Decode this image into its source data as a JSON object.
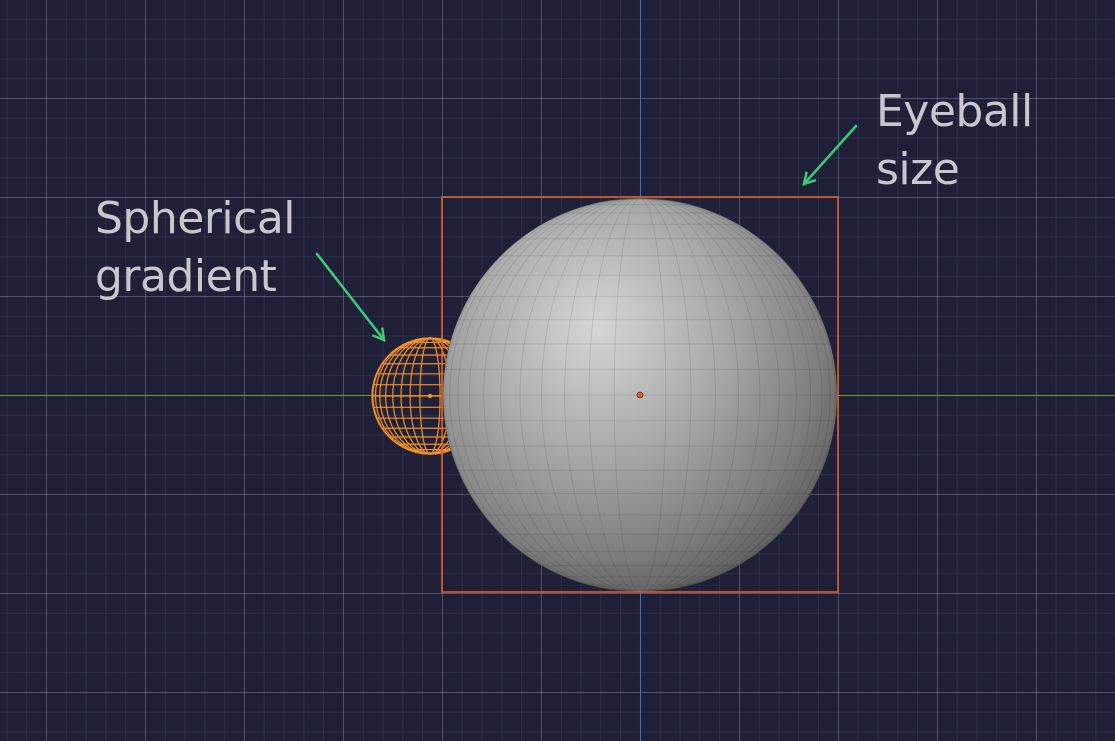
{
  "viewport": {
    "background_color": "#1f2038",
    "x_axis_color": "#6e9a2e",
    "y_axis_color": "#3a72b8"
  },
  "objects": {
    "eyeball": {
      "type": "uv-sphere",
      "shading": "solid-flat",
      "selected": true,
      "bounds_color": "#e0602a",
      "origin_color": "#e0602a"
    },
    "spherical_gradient": {
      "type": "wireframe-sphere",
      "selected": true,
      "wire_color": "#f0902a"
    }
  },
  "annotations": {
    "spherical_gradient": {
      "line1": "Spherical",
      "line2": "gradient",
      "arrow_color": "#3ec97a"
    },
    "eyeball_size": {
      "line1": "Eyeball",
      "line2": "size",
      "arrow_color": "#3ec97a"
    }
  }
}
